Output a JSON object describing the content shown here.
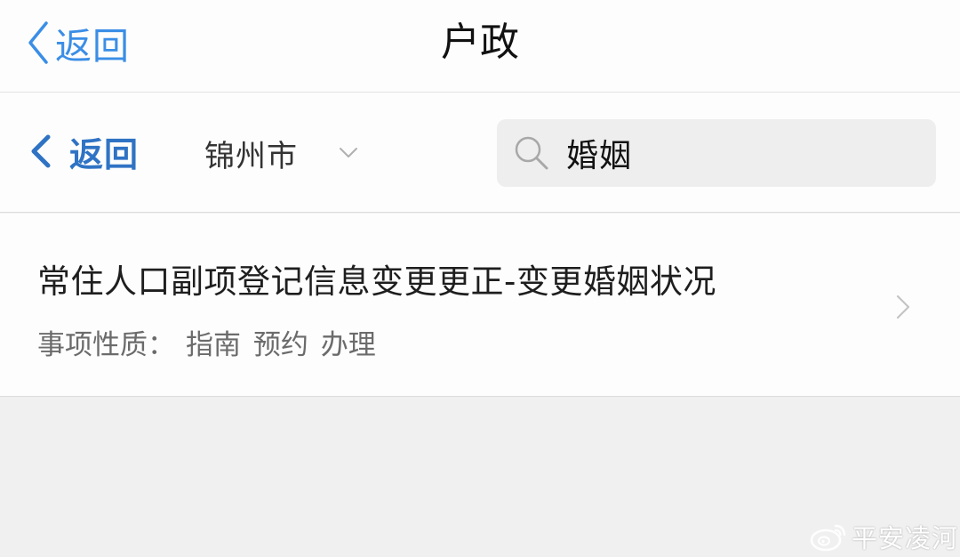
{
  "colors": {
    "accent": "#3a8ee6",
    "accent_dark": "#2f73c4",
    "page_background": "#f0f0f0",
    "card_background": "#fdfdfd",
    "search_background": "#eeeeee"
  },
  "nav": {
    "back_label": "返回",
    "back_icon": "chevron-left-icon",
    "title": "户政"
  },
  "filter": {
    "back_label": "返回",
    "back_icon": "chevron-left-icon",
    "city": "锦州市",
    "city_icon": "chevron-down-icon"
  },
  "search": {
    "icon": "search-icon",
    "value": "婚姻"
  },
  "results": [
    {
      "title": "常住人口副项登记信息变更更正-变更婚姻状况",
      "meta_label": "事项性质：",
      "tags": "指南 预约 办理",
      "arrow_icon": "chevron-right-icon"
    }
  ],
  "watermark": {
    "icon": "weibo-logo",
    "text": "平安凌河"
  }
}
